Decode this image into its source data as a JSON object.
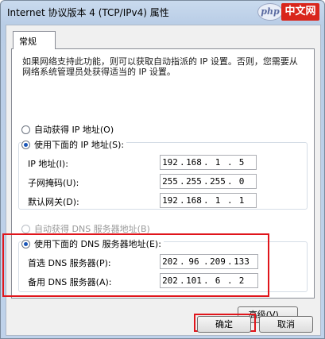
{
  "window": {
    "title": "Internet 协议版本 4 (TCP/IPv4) 属性"
  },
  "watermark": {
    "logo": "php",
    "text": "中文网"
  },
  "tabs": [
    {
      "label": "常规"
    }
  ],
  "description": "如果网络支持此功能，则可以获取自动指派的 IP 设置。否则，您需要从网络系统管理员处获得适当的 IP 设置。",
  "ip": {
    "auto_label": "自动获得 IP 地址(O)",
    "manual_label": "使用下面的 IP 地址(S):",
    "selected": "manual",
    "fields": [
      {
        "label": "IP 地址(I):",
        "value": [
          "192",
          "168",
          "1",
          "5"
        ]
      },
      {
        "label": "子网掩码(U):",
        "value": [
          "255",
          "255",
          "255",
          "0"
        ]
      },
      {
        "label": "默认网关(D):",
        "value": [
          "192",
          "168",
          "1",
          "1"
        ]
      }
    ]
  },
  "dns": {
    "auto_label": "自动获得 DNS 服务器地址(B)",
    "manual_label": "使用下面的 DNS 服务器地址(E):",
    "selected": "manual",
    "fields": [
      {
        "label": "首选 DNS 服务器(P):",
        "value": [
          "202",
          "96",
          "209",
          "133"
        ]
      },
      {
        "label": "备用 DNS 服务器(A):",
        "value": [
          "202",
          "101",
          "6",
          "2"
        ]
      }
    ]
  },
  "buttons": {
    "advanced": "高级(V)...",
    "ok": "确定",
    "cancel": "取消"
  },
  "colors": {
    "highlight": "#e0151b",
    "radio_dot": "#1a56b8"
  }
}
